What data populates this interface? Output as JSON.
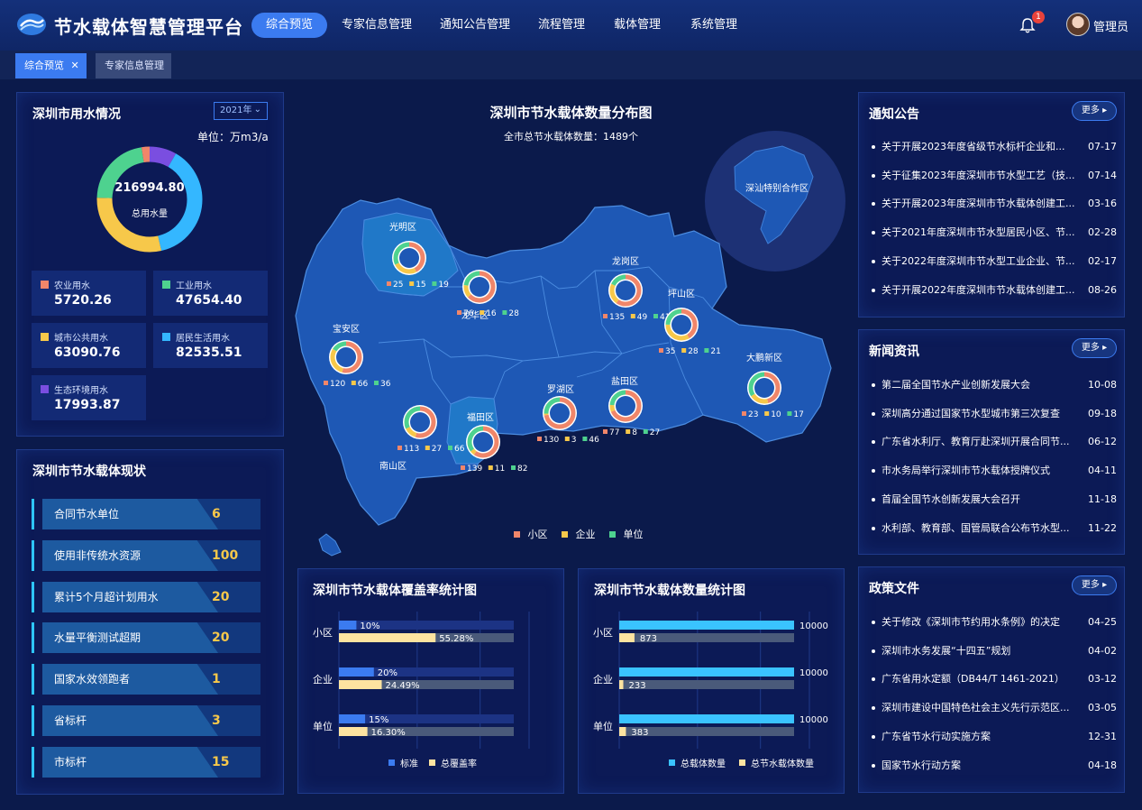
{
  "header": {
    "app_title": "节水载体智慧管理平台",
    "user_name": "管理员",
    "notification_count": "1",
    "nav": [
      "综合预览",
      "专家信息管理",
      "通知公告管理",
      "流程管理",
      "载体管理",
      "系统管理"
    ]
  },
  "tabs": [
    {
      "label": "综合预览",
      "close": "✕"
    },
    {
      "label": "专家信息管理"
    }
  ],
  "water": {
    "title": "深圳市用水情况",
    "year": "2021年",
    "unit": "单位：万m3/a",
    "total": "216994.80",
    "total_label": "总用水量",
    "items": [
      {
        "label": "农业用水",
        "value": "5720.26",
        "color": "#f0866a"
      },
      {
        "label": "工业用水",
        "value": "47654.40",
        "color": "#4ed28f"
      },
      {
        "label": "城市公共用水",
        "value": "63090.76",
        "color": "#f7c84a"
      },
      {
        "label": "居民生活用水",
        "value": "82535.51",
        "color": "#34b7ff"
      },
      {
        "label": "生态环境用水",
        "value": "17993.87",
        "color": "#7a4ee0"
      }
    ]
  },
  "status": {
    "title": "深圳市节水载体现状",
    "rows": [
      {
        "label": "合同节水单位",
        "value": "6"
      },
      {
        "label": "使用非传统水资源",
        "value": "100"
      },
      {
        "label": "累计5个月超计划用水",
        "value": "20"
      },
      {
        "label": "水量平衡测试超期",
        "value": "20"
      },
      {
        "label": "国家水效领跑者",
        "value": "1"
      },
      {
        "label": "省标杆",
        "value": "3"
      },
      {
        "label": "市标杆",
        "value": "15"
      }
    ]
  },
  "map": {
    "title": "深圳市节水载体数量分布图",
    "subtitle": "全市总节水载体数量：1489个",
    "special_zone": "深汕特别合作区",
    "legend": [
      {
        "label": "小区",
        "color": "#f0866a"
      },
      {
        "label": "企业",
        "color": "#f7c84a"
      },
      {
        "label": "单位",
        "color": "#4ed28f"
      }
    ],
    "districts": [
      {
        "name": "光明区",
        "counts": [
          "25",
          "15",
          "19"
        ]
      },
      {
        "name": "龙华区",
        "counts": [
          "76",
          "16",
          "28"
        ]
      },
      {
        "name": "龙岗区",
        "counts": [
          "135",
          "49",
          "41"
        ]
      },
      {
        "name": "坪山区",
        "counts": [
          "35",
          "28",
          "21"
        ]
      },
      {
        "name": "宝安区",
        "counts": [
          "120",
          "66",
          "36"
        ]
      },
      {
        "name": "大鹏新区",
        "counts": [
          "23",
          "10",
          "17"
        ]
      },
      {
        "name": "南山区",
        "counts": [
          "113",
          "27",
          "66"
        ]
      },
      {
        "name": "福田区",
        "counts": [
          "139",
          "11",
          "82"
        ]
      },
      {
        "name": "罗湖区",
        "counts": [
          "130",
          "3",
          "46"
        ]
      },
      {
        "name": "盐田区",
        "counts": [
          "77",
          "8",
          "27"
        ]
      }
    ]
  },
  "coverage": {
    "title": "深圳市节水载体覆盖率统计图",
    "rows": [
      {
        "category": "小区",
        "standard": "10%",
        "total": "55.28%"
      },
      {
        "category": "企业",
        "standard": "20%",
        "total": "24.49%"
      },
      {
        "category": "单位",
        "standard": "15%",
        "total": "16.30%"
      }
    ],
    "legend": [
      "标准",
      "总覆盖率"
    ]
  },
  "quantity": {
    "title": "深圳市节水载体数量统计图",
    "rows": [
      {
        "category": "小区",
        "total": "10000",
        "actual": "873"
      },
      {
        "category": "企业",
        "total": "10000",
        "actual": "233"
      },
      {
        "category": "单位",
        "total": "10000",
        "actual": "383"
      }
    ],
    "legend": [
      "总载体数量",
      "总节水载体数量"
    ]
  },
  "chart_data": [
    {
      "type": "pie",
      "title": "深圳市用水情况",
      "categories": [
        "农业用水",
        "工业用水",
        "城市公共用水",
        "居民生活用水",
        "生态环境用水"
      ],
      "values": [
        5720.26,
        47654.4,
        63090.76,
        82535.51,
        17993.87
      ]
    },
    {
      "type": "bar",
      "title": "深圳市节水载体覆盖率统计图",
      "categories": [
        "小区",
        "企业",
        "单位"
      ],
      "series": [
        {
          "name": "标准",
          "values": [
            10,
            20,
            15
          ]
        },
        {
          "name": "总覆盖率",
          "values": [
            55.28,
            24.49,
            16.3
          ]
        }
      ],
      "xlim": [
        0,
        100
      ]
    },
    {
      "type": "bar",
      "title": "深圳市节水载体数量统计图",
      "categories": [
        "小区",
        "企业",
        "单位"
      ],
      "series": [
        {
          "name": "总载体数量",
          "values": [
            10000,
            10000,
            10000
          ]
        },
        {
          "name": "总节水载体数量",
          "values": [
            873,
            233,
            383
          ]
        }
      ],
      "xlim": [
        0,
        10000
      ]
    }
  ],
  "notices": {
    "title": "通知公告",
    "more": "更多",
    "items": [
      {
        "text": "关于开展2023年度省级节水标杆企业和...",
        "date": "07-17"
      },
      {
        "text": "关于征集2023年度深圳市节水型工艺（技...",
        "date": "07-14"
      },
      {
        "text": "关于开展2023年度深圳市节水载体创建工...",
        "date": "03-16"
      },
      {
        "text": "关于2021年度深圳市节水型居民小区、节...",
        "date": "02-28"
      },
      {
        "text": "关于2022年度深圳市节水型工业企业、节...",
        "date": "02-17"
      },
      {
        "text": "关于开展2022年度深圳市节水载体创建工...",
        "date": "08-26"
      }
    ]
  },
  "news": {
    "title": "新闻资讯",
    "more": "更多",
    "items": [
      {
        "text": "第二届全国节水产业创新发展大会",
        "date": "10-08"
      },
      {
        "text": "深圳高分通过国家节水型城市第三次复查",
        "date": "09-18"
      },
      {
        "text": "广东省水利厅、教育厅赴深圳开展合同节...",
        "date": "06-12"
      },
      {
        "text": "市水务局举行深圳市节水载体授牌仪式",
        "date": "04-11"
      },
      {
        "text": "首届全国节水创新发展大会召开",
        "date": "11-18"
      },
      {
        "text": "水利部、教育部、国管局联合公布节水型...",
        "date": "11-22"
      }
    ]
  },
  "policy": {
    "title": "政策文件",
    "more": "更多",
    "items": [
      {
        "text": "关于修改《深圳市节约用水条例》的决定",
        "date": "04-25"
      },
      {
        "text": "深圳市水务发展“十四五”规划",
        "date": "04-02"
      },
      {
        "text": "广东省用水定额（DB44/T 1461-2021）",
        "date": "03-12"
      },
      {
        "text": "深圳市建设中国特色社会主义先行示范区...",
        "date": "03-05"
      },
      {
        "text": "广东省节水行动实施方案",
        "date": "12-31"
      },
      {
        "text": "国家节水行动方案",
        "date": "04-18"
      }
    ]
  }
}
